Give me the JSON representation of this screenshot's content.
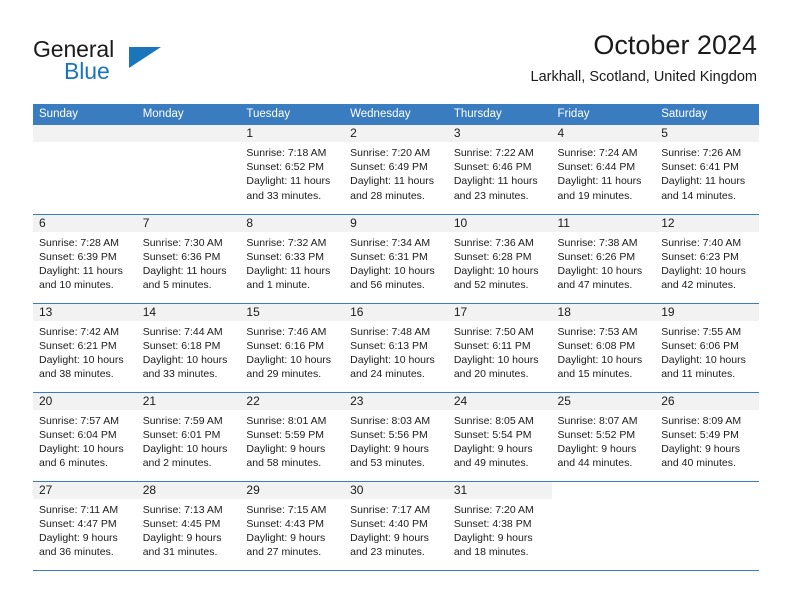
{
  "brand": {
    "name_part1": "General",
    "name_part2": "Blue",
    "triangle_color": "#1b75bb"
  },
  "header": {
    "title": "October 2024",
    "subtitle": "Larkhall, Scotland, United Kingdom"
  },
  "theme": {
    "header_row_bg": "#3a7cc0",
    "header_row_text": "#ffffff",
    "daynum_bg": "#f2f2f2",
    "grid_line": "#3a7cc0",
    "text": "#1b1b1b"
  },
  "weekday_headers": [
    "Sunday",
    "Monday",
    "Tuesday",
    "Wednesday",
    "Thursday",
    "Friday",
    "Saturday"
  ],
  "labels": {
    "sunrise_prefix": "Sunrise:",
    "sunset_prefix": "Sunset:",
    "daylight_prefix": "Daylight:"
  },
  "weeks": [
    [
      {
        "blank": true,
        "day": "",
        "sunrise": "",
        "sunset": "",
        "daylight": ""
      },
      {
        "blank": true,
        "day": "",
        "sunrise": "",
        "sunset": "",
        "daylight": ""
      },
      {
        "blank": false,
        "day": "1",
        "sunrise": "Sunrise: 7:18 AM",
        "sunset": "Sunset: 6:52 PM",
        "daylight": "Daylight: 11 hours and 33 minutes."
      },
      {
        "blank": false,
        "day": "2",
        "sunrise": "Sunrise: 7:20 AM",
        "sunset": "Sunset: 6:49 PM",
        "daylight": "Daylight: 11 hours and 28 minutes."
      },
      {
        "blank": false,
        "day": "3",
        "sunrise": "Sunrise: 7:22 AM",
        "sunset": "Sunset: 6:46 PM",
        "daylight": "Daylight: 11 hours and 23 minutes."
      },
      {
        "blank": false,
        "day": "4",
        "sunrise": "Sunrise: 7:24 AM",
        "sunset": "Sunset: 6:44 PM",
        "daylight": "Daylight: 11 hours and 19 minutes."
      },
      {
        "blank": false,
        "day": "5",
        "sunrise": "Sunrise: 7:26 AM",
        "sunset": "Sunset: 6:41 PM",
        "daylight": "Daylight: 11 hours and 14 minutes."
      }
    ],
    [
      {
        "blank": false,
        "day": "6",
        "sunrise": "Sunrise: 7:28 AM",
        "sunset": "Sunset: 6:39 PM",
        "daylight": "Daylight: 11 hours and 10 minutes."
      },
      {
        "blank": false,
        "day": "7",
        "sunrise": "Sunrise: 7:30 AM",
        "sunset": "Sunset: 6:36 PM",
        "daylight": "Daylight: 11 hours and 5 minutes."
      },
      {
        "blank": false,
        "day": "8",
        "sunrise": "Sunrise: 7:32 AM",
        "sunset": "Sunset: 6:33 PM",
        "daylight": "Daylight: 11 hours and 1 minute."
      },
      {
        "blank": false,
        "day": "9",
        "sunrise": "Sunrise: 7:34 AM",
        "sunset": "Sunset: 6:31 PM",
        "daylight": "Daylight: 10 hours and 56 minutes."
      },
      {
        "blank": false,
        "day": "10",
        "sunrise": "Sunrise: 7:36 AM",
        "sunset": "Sunset: 6:28 PM",
        "daylight": "Daylight: 10 hours and 52 minutes."
      },
      {
        "blank": false,
        "day": "11",
        "sunrise": "Sunrise: 7:38 AM",
        "sunset": "Sunset: 6:26 PM",
        "daylight": "Daylight: 10 hours and 47 minutes."
      },
      {
        "blank": false,
        "day": "12",
        "sunrise": "Sunrise: 7:40 AM",
        "sunset": "Sunset: 6:23 PM",
        "daylight": "Daylight: 10 hours and 42 minutes."
      }
    ],
    [
      {
        "blank": false,
        "day": "13",
        "sunrise": "Sunrise: 7:42 AM",
        "sunset": "Sunset: 6:21 PM",
        "daylight": "Daylight: 10 hours and 38 minutes."
      },
      {
        "blank": false,
        "day": "14",
        "sunrise": "Sunrise: 7:44 AM",
        "sunset": "Sunset: 6:18 PM",
        "daylight": "Daylight: 10 hours and 33 minutes."
      },
      {
        "blank": false,
        "day": "15",
        "sunrise": "Sunrise: 7:46 AM",
        "sunset": "Sunset: 6:16 PM",
        "daylight": "Daylight: 10 hours and 29 minutes."
      },
      {
        "blank": false,
        "day": "16",
        "sunrise": "Sunrise: 7:48 AM",
        "sunset": "Sunset: 6:13 PM",
        "daylight": "Daylight: 10 hours and 24 minutes."
      },
      {
        "blank": false,
        "day": "17",
        "sunrise": "Sunrise: 7:50 AM",
        "sunset": "Sunset: 6:11 PM",
        "daylight": "Daylight: 10 hours and 20 minutes."
      },
      {
        "blank": false,
        "day": "18",
        "sunrise": "Sunrise: 7:53 AM",
        "sunset": "Sunset: 6:08 PM",
        "daylight": "Daylight: 10 hours and 15 minutes."
      },
      {
        "blank": false,
        "day": "19",
        "sunrise": "Sunrise: 7:55 AM",
        "sunset": "Sunset: 6:06 PM",
        "daylight": "Daylight: 10 hours and 11 minutes."
      }
    ],
    [
      {
        "blank": false,
        "day": "20",
        "sunrise": "Sunrise: 7:57 AM",
        "sunset": "Sunset: 6:04 PM",
        "daylight": "Daylight: 10 hours and 6 minutes."
      },
      {
        "blank": false,
        "day": "21",
        "sunrise": "Sunrise: 7:59 AM",
        "sunset": "Sunset: 6:01 PM",
        "daylight": "Daylight: 10 hours and 2 minutes."
      },
      {
        "blank": false,
        "day": "22",
        "sunrise": "Sunrise: 8:01 AM",
        "sunset": "Sunset: 5:59 PM",
        "daylight": "Daylight: 9 hours and 58 minutes."
      },
      {
        "blank": false,
        "day": "23",
        "sunrise": "Sunrise: 8:03 AM",
        "sunset": "Sunset: 5:56 PM",
        "daylight": "Daylight: 9 hours and 53 minutes."
      },
      {
        "blank": false,
        "day": "24",
        "sunrise": "Sunrise: 8:05 AM",
        "sunset": "Sunset: 5:54 PM",
        "daylight": "Daylight: 9 hours and 49 minutes."
      },
      {
        "blank": false,
        "day": "25",
        "sunrise": "Sunrise: 8:07 AM",
        "sunset": "Sunset: 5:52 PM",
        "daylight": "Daylight: 9 hours and 44 minutes."
      },
      {
        "blank": false,
        "day": "26",
        "sunrise": "Sunrise: 8:09 AM",
        "sunset": "Sunset: 5:49 PM",
        "daylight": "Daylight: 9 hours and 40 minutes."
      }
    ],
    [
      {
        "blank": false,
        "day": "27",
        "sunrise": "Sunrise: 7:11 AM",
        "sunset": "Sunset: 4:47 PM",
        "daylight": "Daylight: 9 hours and 36 minutes."
      },
      {
        "blank": false,
        "day": "28",
        "sunrise": "Sunrise: 7:13 AM",
        "sunset": "Sunset: 4:45 PM",
        "daylight": "Daylight: 9 hours and 31 minutes."
      },
      {
        "blank": false,
        "day": "29",
        "sunrise": "Sunrise: 7:15 AM",
        "sunset": "Sunset: 4:43 PM",
        "daylight": "Daylight: 9 hours and 27 minutes."
      },
      {
        "blank": false,
        "day": "30",
        "sunrise": "Sunrise: 7:17 AM",
        "sunset": "Sunset: 4:40 PM",
        "daylight": "Daylight: 9 hours and 23 minutes."
      },
      {
        "blank": false,
        "day": "31",
        "sunrise": "Sunrise: 7:20 AM",
        "sunset": "Sunset: 4:38 PM",
        "daylight": "Daylight: 9 hours and 18 minutes."
      },
      {
        "blank": true,
        "day": "",
        "sunrise": "",
        "sunset": "",
        "daylight": ""
      },
      {
        "blank": true,
        "day": "",
        "sunrise": "",
        "sunset": "",
        "daylight": ""
      }
    ]
  ]
}
